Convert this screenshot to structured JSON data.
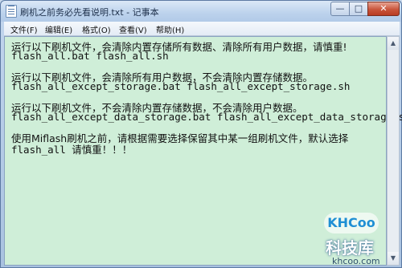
{
  "window": {
    "title": "刷机之前务必先看说明.txt - 记事本",
    "minimize_glyph": "—",
    "maximize_glyph": "□",
    "close_glyph": "✕",
    "icon": "notepad-icon"
  },
  "menu": {
    "file": "文件(F)",
    "edit": "编辑(E)",
    "format": "格式(O)",
    "view": "查看(V)",
    "help": "帮助(H)"
  },
  "content": {
    "lines": [
      "运行以下刷机文件，会清除内置存储所有数据、清除所有用户数据，请慎重!",
      "flash_all.bat flash_all.sh",
      "",
      "运行以下刷机文件，会清除所有用户数据，不会清除内置存储数据。",
      "flash_all_except_storage.bat flash_all_except_storage.sh",
      "",
      "运行以下刷机文件，不会清除内置存储数据，不会清除用户数据。",
      "flash_all_except_data_storage.bat flash_all_except_data_storage.sh",
      "",
      "使用Miflash刷机之前，请根据需要选择保留其中某一组刷机文件，默认选择",
      "flash_all 请慎重！！！"
    ]
  },
  "scrollbar": {
    "up_glyph": "▲",
    "down_glyph": "▼"
  },
  "watermark": {
    "badge": "KHCoo",
    "name": "科技库",
    "url": "khcoo.com"
  }
}
